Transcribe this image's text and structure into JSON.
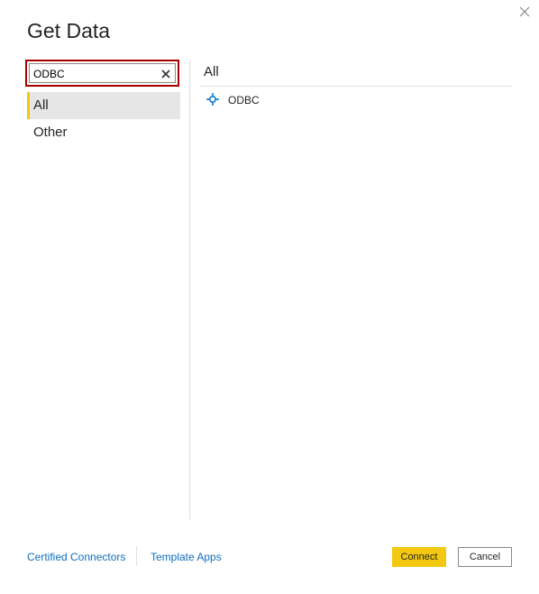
{
  "dialog": {
    "title": "Get Data"
  },
  "search": {
    "value": "ODBC",
    "placeholder": ""
  },
  "categories": [
    {
      "label": "All",
      "selected": true
    },
    {
      "label": "Other",
      "selected": false
    }
  ],
  "results": {
    "header": "All",
    "items": [
      {
        "label": "ODBC",
        "icon": "odbc-connector-icon"
      }
    ]
  },
  "footer": {
    "certified_connectors": "Certified Connectors",
    "template_apps": "Template Apps",
    "connect_label": "Connect",
    "cancel_label": "Cancel"
  },
  "colors": {
    "accent": "#f2c811",
    "search_highlight_border": "#a80000",
    "link": "#106ebe",
    "selected_bg": "#e6e6e6"
  }
}
